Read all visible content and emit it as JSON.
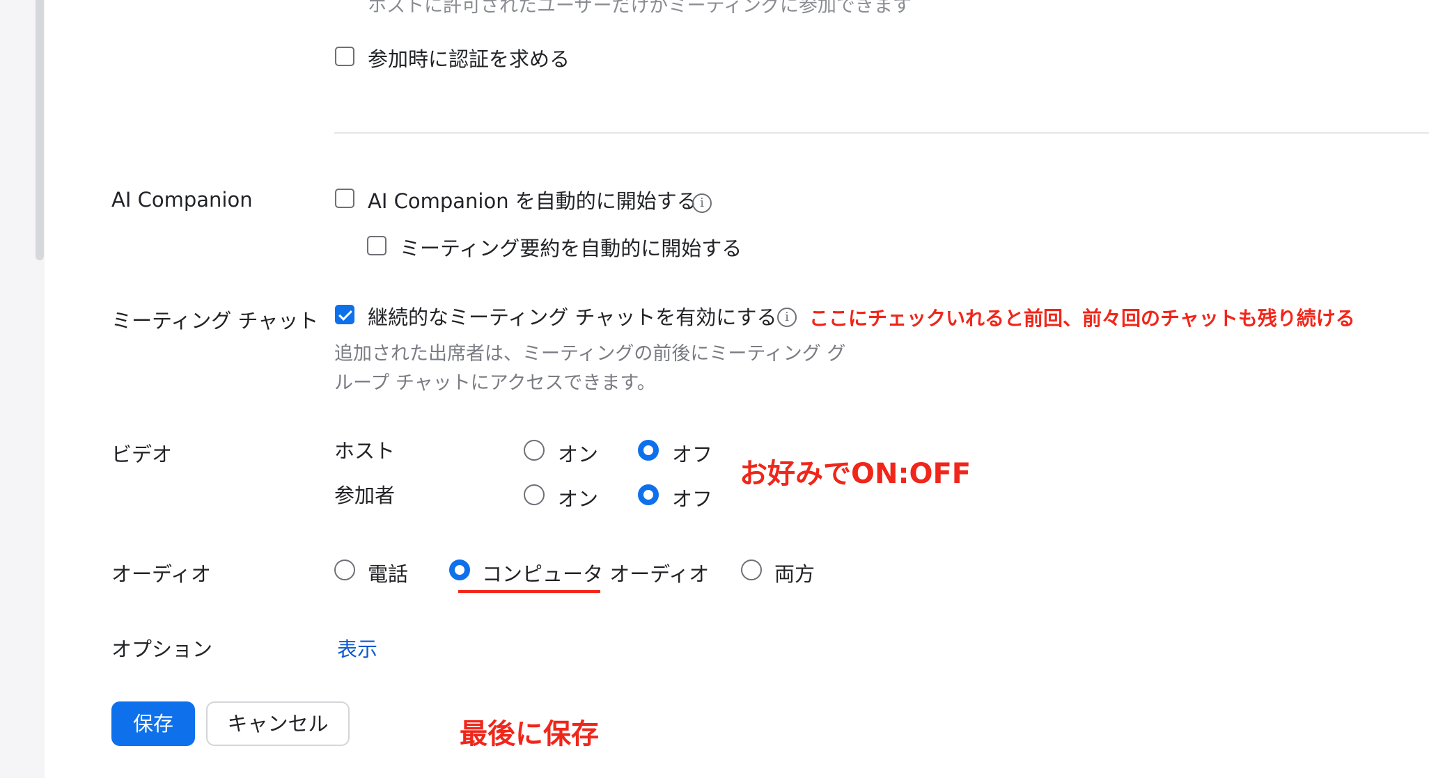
{
  "header_partial_text": "ホストに許可されたユーザーだけがミーティングに参加できます",
  "auth": {
    "checkbox_label": "参加時に認証を求める",
    "checked": false
  },
  "ai_companion": {
    "label": "AI Companion",
    "auto_start": {
      "label": "AI Companion を自動的に開始する",
      "checked": false,
      "info_icon": "info-icon"
    },
    "summary": {
      "label": "ミーティング要約を自動的に開始する",
      "checked": false
    }
  },
  "meeting_chat": {
    "label": "ミーティング チャット",
    "persistent": {
      "label": "継続的なミーティング チャットを有効にする",
      "checked": true,
      "info_icon": "info-icon"
    },
    "description_line1": "追加された出席者は、ミーティングの前後にミーティング グ",
    "description_line2": "ループ チャットにアクセスできます。",
    "annotation": "ここにチェックいれると前回、前々回のチャットも残り続ける"
  },
  "video": {
    "label": "ビデオ",
    "host": {
      "label": "ホスト",
      "on": "オン",
      "off": "オフ",
      "selected": "off"
    },
    "participant": {
      "label": "参加者",
      "on": "オン",
      "off": "オフ",
      "selected": "off"
    },
    "annotation": "お好みでON:OFF"
  },
  "audio": {
    "label": "オーディオ",
    "options": [
      "電話",
      "コンピュータ オーディオ",
      "両方"
    ],
    "selected": "コンピュータ オーディオ"
  },
  "options": {
    "label": "オプション",
    "link": "表示"
  },
  "buttons": {
    "save": "保存",
    "cancel": "キャンセル"
  },
  "save_annotation": "最後に保存",
  "colors": {
    "accent": "#0e71eb",
    "annotation": "#f0261a",
    "link": "#0e5ad1"
  }
}
